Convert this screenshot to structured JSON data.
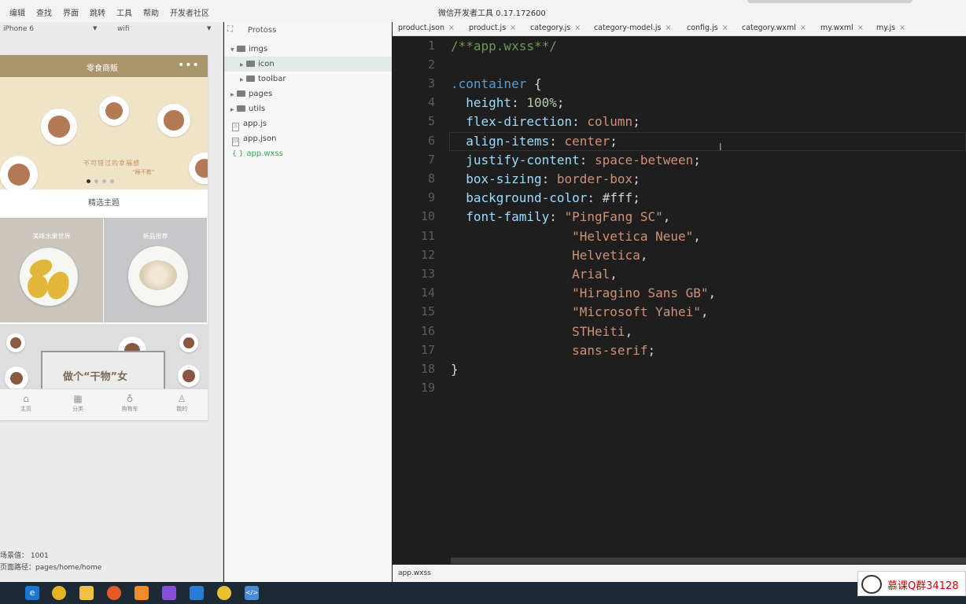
{
  "menubar": {
    "items": [
      "编辑",
      "查找",
      "界面",
      "跳转",
      "工具",
      "帮助",
      "开发者社区"
    ],
    "window_title": "微信开发者工具 0.17.172600"
  },
  "simulator": {
    "device": "iPhone 6",
    "network": "wifi",
    "app": {
      "nav_title": "零食商贩",
      "nav_more": "•••",
      "slogan": "不可错过的幸福感",
      "slogan2": "“睡不着”",
      "theme_title": "精选主题",
      "tiles": [
        {
          "label": "美味水果世界"
        },
        {
          "label": "新品推荐"
        }
      ],
      "promo_text": "做个“干物”女",
      "tabs": [
        {
          "icon": "⌂",
          "label": "主页"
        },
        {
          "icon": "▦",
          "label": "分类"
        },
        {
          "icon": "♁",
          "label": "购物车"
        },
        {
          "icon": "♙",
          "label": "我的"
        }
      ]
    },
    "footer": {
      "scene": "场景值：  1001",
      "path": "页面路径：pages/home/home"
    }
  },
  "tree": {
    "project": "Protoss",
    "project_icon": "⛶",
    "items": [
      {
        "name": "imgs",
        "type": "folder",
        "arrow": "▼"
      },
      {
        "name": "icon",
        "type": "folder",
        "arrow": "▶"
      },
      {
        "name": "toolbar",
        "type": "folder",
        "arrow": "▶"
      },
      {
        "name": "pages",
        "type": "folder",
        "arrow": "▶"
      },
      {
        "name": "utils",
        "type": "folder",
        "arrow": "▶"
      },
      {
        "name": "app.js",
        "type": "file",
        "badge": "JS"
      },
      {
        "name": "app.json",
        "type": "file",
        "badge": "JSN"
      },
      {
        "name": "app.wxss",
        "type": "file",
        "badge": "{ }"
      }
    ]
  },
  "editor": {
    "tabs": [
      {
        "name": "product.json"
      },
      {
        "name": "product.js"
      },
      {
        "name": "category.js"
      },
      {
        "name": "category-model.js"
      },
      {
        "name": "config.js"
      },
      {
        "name": "category.wxml"
      },
      {
        "name": "my.wxml"
      },
      {
        "name": "my.js"
      }
    ],
    "tab_close": "×",
    "lines": [
      "1",
      "2",
      "3",
      "4",
      "5",
      "6",
      "7",
      "8",
      "9",
      "10",
      "11",
      "12",
      "13",
      "14",
      "15",
      "16",
      "17",
      "18",
      "19"
    ],
    "status_file": "app.wxss"
  },
  "watermark": {
    "text": "慕课Q群34128"
  }
}
